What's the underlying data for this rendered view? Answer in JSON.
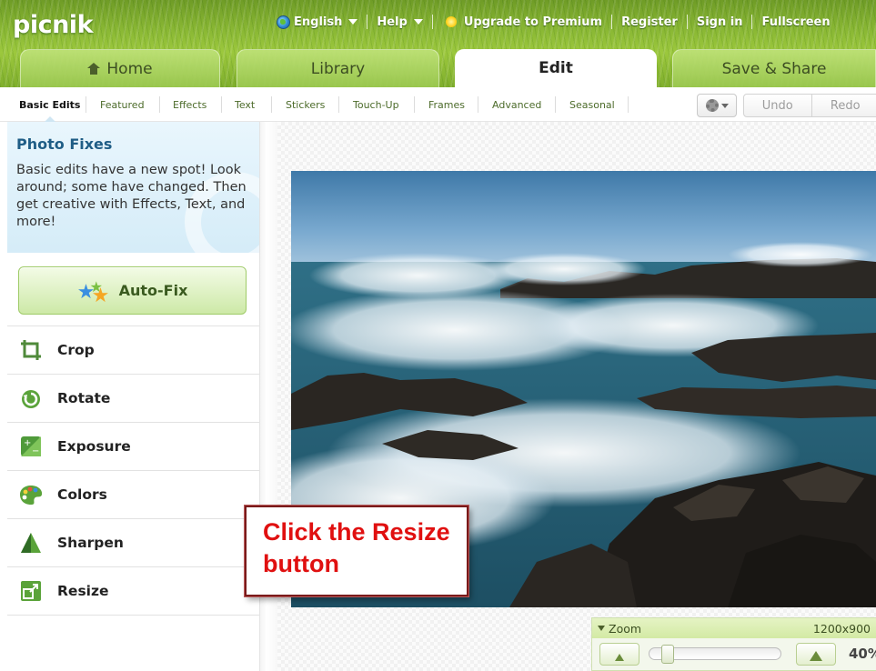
{
  "header": {
    "logo": "picnik",
    "nav": {
      "language": "English",
      "help": "Help",
      "upgrade": "Upgrade to Premium",
      "register": "Register",
      "signin": "Sign in",
      "fullscreen": "Fullscreen"
    },
    "tabs": [
      {
        "label": "Home"
      },
      {
        "label": "Library"
      },
      {
        "label": "Edit"
      },
      {
        "label": "Save & Share"
      }
    ]
  },
  "subtabs": [
    "Basic Edits",
    "Featured",
    "Effects",
    "Text",
    "Stickers",
    "Touch-Up",
    "Frames",
    "Advanced",
    "Seasonal"
  ],
  "actions": {
    "undo": "Undo",
    "redo": "Redo"
  },
  "panel": {
    "title": "Photo Fixes",
    "description": "Basic edits have a new spot! Look around; some have changed. Then get creative with Effects, Text, and more!",
    "autofix": "Auto-Fix",
    "tools": [
      {
        "label": "Crop",
        "icon": "crop-icon"
      },
      {
        "label": "Rotate",
        "icon": "rotate-icon"
      },
      {
        "label": "Exposure",
        "icon": "exposure-icon"
      },
      {
        "label": "Colors",
        "icon": "palette-icon"
      },
      {
        "label": "Sharpen",
        "icon": "sharpen-icon"
      },
      {
        "label": "Resize",
        "icon": "resize-icon"
      }
    ]
  },
  "callout": {
    "text": "Click the Resize button"
  },
  "zoom": {
    "label": "Zoom",
    "dimensions": "1200x900",
    "percent": "40%",
    "level": 0.4
  },
  "colors": {
    "brand_green": "#8ab834",
    "callout_red": "#e01010",
    "panel_blue": "#1f5d86"
  }
}
